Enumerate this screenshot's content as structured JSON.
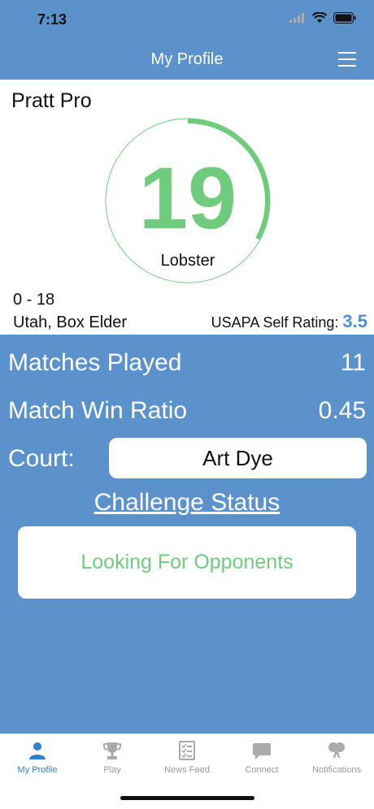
{
  "status": {
    "time": "7:13"
  },
  "nav": {
    "title": "My Profile"
  },
  "profile": {
    "name": "Pratt Pro",
    "rating_number": "19",
    "rating_label": "Lobster",
    "ring_progress": 0.33,
    "record": "0 - 18",
    "location": "Utah, Box Elder",
    "self_rating_label": "USAPA Self Rating:",
    "self_rating_value": "3.5"
  },
  "stats": {
    "matches_played_label": "Matches Played",
    "matches_played_value": "11",
    "win_ratio_label": "Match Win Ratio",
    "win_ratio_value": "0.45"
  },
  "court": {
    "label": "Court:",
    "value": "Art Dye"
  },
  "challenge": {
    "link": "Challenge Status",
    "status": "Looking For Opponents"
  },
  "tabs": [
    {
      "label": "My Profile",
      "icon": "person-icon"
    },
    {
      "label": "Play",
      "icon": "trophy-icon"
    },
    {
      "label": "News Feed",
      "icon": "checklist-icon"
    },
    {
      "label": "Connect",
      "icon": "chat-bubble-icon"
    },
    {
      "label": "Notifications",
      "icon": "paddles-icon"
    }
  ],
  "colors": {
    "background": "#5b92cc",
    "accent_green": "#6fcc7c",
    "rating_blue": "#4f8fcf",
    "active_tab": "#2f7fd6"
  }
}
